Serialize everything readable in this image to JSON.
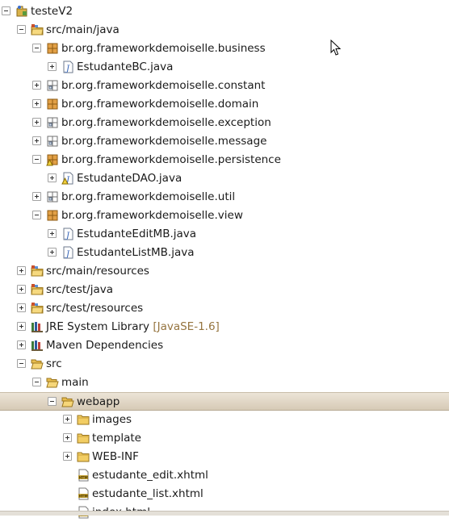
{
  "project": {
    "name": "testeV2"
  },
  "tree": [
    {
      "label": "testeV2",
      "icon": "project-icon",
      "state": "expanded"
    },
    {
      "label": "src/main/java",
      "icon": "source-folder-icon",
      "state": "expanded"
    },
    {
      "label": "br.org.frameworkdemoiselle.business",
      "icon": "package-icon",
      "state": "expanded"
    },
    {
      "label": "EstudanteBC.java",
      "icon": "java-file-icon",
      "state": "collapsed"
    },
    {
      "label": "br.org.frameworkdemoiselle.constant",
      "icon": "empty-package-icon",
      "state": "collapsed"
    },
    {
      "label": "br.org.frameworkdemoiselle.domain",
      "icon": "package-icon",
      "state": "collapsed"
    },
    {
      "label": "br.org.frameworkdemoiselle.exception",
      "icon": "empty-package-icon",
      "state": "collapsed"
    },
    {
      "label": "br.org.frameworkdemoiselle.message",
      "icon": "empty-package-icon",
      "state": "collapsed"
    },
    {
      "label": "br.org.frameworkdemoiselle.persistence",
      "icon": "package-warning-icon",
      "state": "expanded"
    },
    {
      "label": "EstudanteDAO.java",
      "icon": "java-file-warning-icon",
      "state": "collapsed"
    },
    {
      "label": "br.org.frameworkdemoiselle.util",
      "icon": "empty-package-icon",
      "state": "collapsed"
    },
    {
      "label": "br.org.frameworkdemoiselle.view",
      "icon": "package-icon",
      "state": "expanded"
    },
    {
      "label": "EstudanteEditMB.java",
      "icon": "java-file-icon",
      "state": "collapsed"
    },
    {
      "label": "EstudanteListMB.java",
      "icon": "java-file-icon",
      "state": "collapsed"
    },
    {
      "label": "src/main/resources",
      "icon": "source-folder-icon",
      "state": "collapsed"
    },
    {
      "label": "src/test/java",
      "icon": "source-folder-icon",
      "state": "collapsed"
    },
    {
      "label": "src/test/resources",
      "icon": "source-folder-icon",
      "state": "collapsed"
    },
    {
      "label": "JRE System Library",
      "decoration": "[JavaSE-1.6]",
      "icon": "library-icon",
      "state": "collapsed"
    },
    {
      "label": "Maven Dependencies",
      "icon": "library-icon",
      "state": "collapsed"
    },
    {
      "label": "src",
      "icon": "folder-open-icon",
      "state": "expanded"
    },
    {
      "label": "main",
      "icon": "folder-open-icon",
      "state": "expanded"
    },
    {
      "label": "webapp",
      "icon": "folder-open-icon",
      "state": "expanded",
      "selected": true
    },
    {
      "label": "images",
      "icon": "folder-icon",
      "state": "collapsed"
    },
    {
      "label": "template",
      "icon": "folder-icon",
      "state": "collapsed"
    },
    {
      "label": "WEB-INF",
      "icon": "folder-icon",
      "state": "collapsed"
    },
    {
      "label": "estudante_edit.xhtml",
      "icon": "html-file-icon",
      "state": "leaf"
    },
    {
      "label": "estudante_list.xhtml",
      "icon": "html-file-icon",
      "state": "leaf"
    },
    {
      "label": "index.html",
      "icon": "html-file-icon",
      "state": "leaf"
    }
  ],
  "colors": {
    "selection": "#dcd2c1",
    "decoration": "#95743f"
  }
}
